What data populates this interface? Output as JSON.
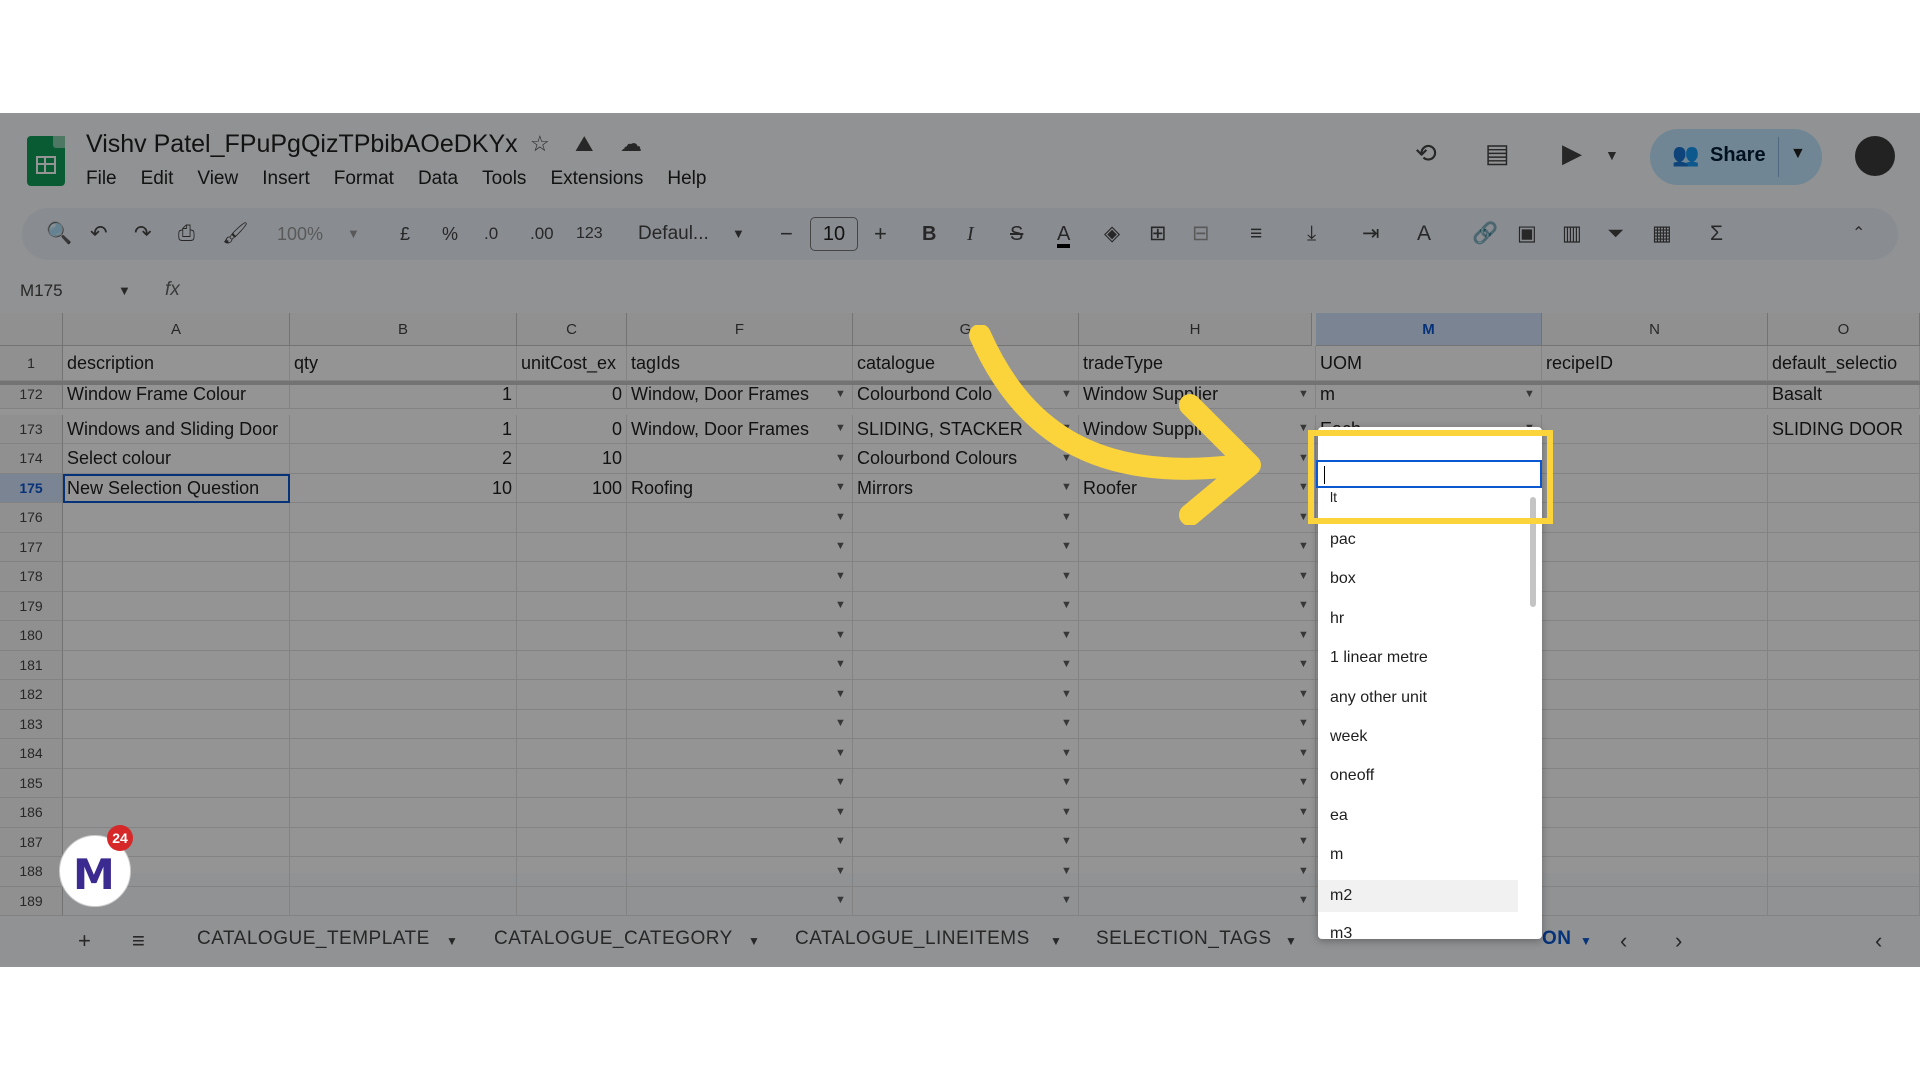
{
  "doc": {
    "title": "Vishv Patel_FPuPgQizTPbibAOeDKYx"
  },
  "menu": [
    "File",
    "Edit",
    "View",
    "Insert",
    "Format",
    "Data",
    "Tools",
    "Extensions",
    "Help"
  ],
  "share": {
    "label": "Share"
  },
  "toolbar": {
    "zoom": "100%",
    "currency": "£",
    "percent": "%",
    "dec_minus": ".0",
    "dec_plus": ".00",
    "num_format": "123",
    "font": "Defaul...",
    "font_size": "10",
    "bold": "B",
    "italic": "I",
    "sum": "Σ"
  },
  "formula_bar": {
    "name_box": "M175",
    "fx": "fx"
  },
  "columns": [
    "A",
    "B",
    "C",
    "F",
    "G",
    "H",
    "M",
    "N",
    "O"
  ],
  "headers": [
    "description",
    "qty",
    "unitCost_ex",
    "tagIds",
    "catalogue",
    "tradeType",
    "UOM",
    "recipeID",
    "default_selectio"
  ],
  "rows": [
    {
      "num": "172",
      "cells": [
        "Window Frame Colour",
        "1",
        "0",
        "Window, Door Frames",
        "Colourbond Colo",
        "Window Supplier",
        "m",
        "",
        "Basalt"
      ]
    },
    {
      "num": "173",
      "cells": [
        "Windows and Sliding Door",
        "1",
        "0",
        "Window, Door Frames",
        "SLIDING, STACKER",
        "Window Supplier",
        "Each",
        "",
        "SLIDING DOOR"
      ]
    },
    {
      "num": "174",
      "cells": [
        "Select colour",
        "2",
        "10",
        "",
        "Colourbond Colours",
        "",
        "lt",
        "",
        ""
      ]
    },
    {
      "num": "175",
      "cells": [
        "New Selection Question",
        "10",
        "100",
        "Roofing",
        "Mirrors",
        "Roofer",
        "",
        "",
        ""
      ]
    },
    {
      "num": "176",
      "cells": [
        "",
        "",
        "",
        "",
        "",
        "",
        "",
        "",
        ""
      ]
    },
    {
      "num": "177",
      "cells": [
        "",
        "",
        "",
        "",
        "",
        "",
        "",
        "",
        ""
      ]
    },
    {
      "num": "178",
      "cells": [
        "",
        "",
        "",
        "",
        "",
        "",
        "",
        "",
        ""
      ]
    },
    {
      "num": "179",
      "cells": [
        "",
        "",
        "",
        "",
        "",
        "",
        "",
        "",
        ""
      ]
    },
    {
      "num": "180",
      "cells": [
        "",
        "",
        "",
        "",
        "",
        "",
        "",
        "",
        ""
      ]
    },
    {
      "num": "181",
      "cells": [
        "",
        "",
        "",
        "",
        "",
        "",
        "",
        "",
        ""
      ]
    },
    {
      "num": "182",
      "cells": [
        "",
        "",
        "",
        "",
        "",
        "",
        "",
        "",
        ""
      ]
    },
    {
      "num": "183",
      "cells": [
        "",
        "",
        "",
        "",
        "",
        "",
        "",
        "",
        ""
      ]
    },
    {
      "num": "184",
      "cells": [
        "",
        "",
        "",
        "",
        "",
        "",
        "",
        "",
        ""
      ]
    },
    {
      "num": "185",
      "cells": [
        "",
        "",
        "",
        "",
        "",
        "",
        "",
        "",
        ""
      ]
    },
    {
      "num": "186",
      "cells": [
        "",
        "",
        "",
        "",
        "",
        "",
        "",
        "",
        ""
      ]
    },
    {
      "num": "187",
      "cells": [
        "",
        "",
        "",
        "",
        "",
        "",
        "",
        "",
        ""
      ]
    },
    {
      "num": "188",
      "cells": [
        "",
        "",
        "",
        "",
        "",
        "",
        "",
        "",
        ""
      ]
    },
    {
      "num": "189",
      "cells": [
        "",
        "",
        "",
        "",
        "",
        "",
        "",
        "",
        ""
      ]
    }
  ],
  "frozen_row_num": "1",
  "dropdown": {
    "current": "lt",
    "input_value": "",
    "options": [
      "lt",
      "pac",
      "box",
      "hr",
      "1 linear metre",
      "any other unit",
      "week",
      "oneoff",
      "ea",
      "m",
      "m2",
      "m3"
    ],
    "highlighted": "m2"
  },
  "sheet_tabs": [
    "CATALOGUE_TEMPLATE",
    "CATALOGUE_CATEGORY",
    "CATALOGUE_LINEITEMS",
    "SELECTION_TAGS"
  ],
  "sheet_tab_partial": "ON",
  "badge": {
    "count": "24",
    "letter": "M"
  },
  "colors": {
    "highlight": "#fbd33a",
    "selection": "#0b57d0",
    "sheets_green": "#0f9d58"
  }
}
